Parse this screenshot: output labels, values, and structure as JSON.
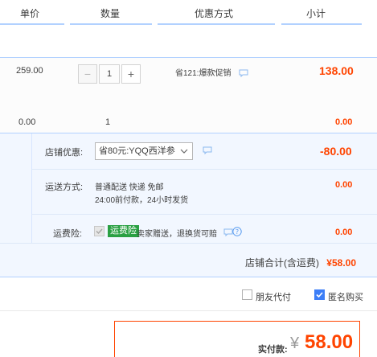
{
  "header": {
    "col_price": "单价",
    "col_qty": "数量",
    "col_promo": "优惠方式",
    "col_subtotal": "小计"
  },
  "item": {
    "price": "259.00",
    "quantity": "1",
    "promo": "省121:爆款促销",
    "subtotal": "138.00"
  },
  "sub_item": {
    "price": "0.00",
    "quantity": "1",
    "subtotal": "0.00"
  },
  "shop": {
    "discount_label": "店铺优惠:",
    "discount_selected": "省80元:YQQ西洋参",
    "discount_amount": "-80.00",
    "shipping_label": "运送方式:",
    "shipping_method": "普通配送 快递 免邮",
    "shipping_note": "24:00前付款，24小时发货",
    "shipping_amount": "0.00",
    "insurance_label": "运费险:",
    "insurance_tag": "运费险",
    "insurance_desc": "卖家赠送，退换货可赔",
    "insurance_amount": "0.00",
    "total_label": "店铺合计(含运费)",
    "total_amount": "¥58.00"
  },
  "options": {
    "friend_pay": "朋友代付",
    "anonymous": "匿名购买"
  },
  "payment": {
    "label": "实付款:",
    "currency": "¥",
    "amount": "58.00"
  },
  "colors": {
    "accent": "#ff4400",
    "blue_line": "#b2d1ff",
    "checkbox_blue": "#3c7ef7",
    "tag_green": "#2aa043"
  }
}
